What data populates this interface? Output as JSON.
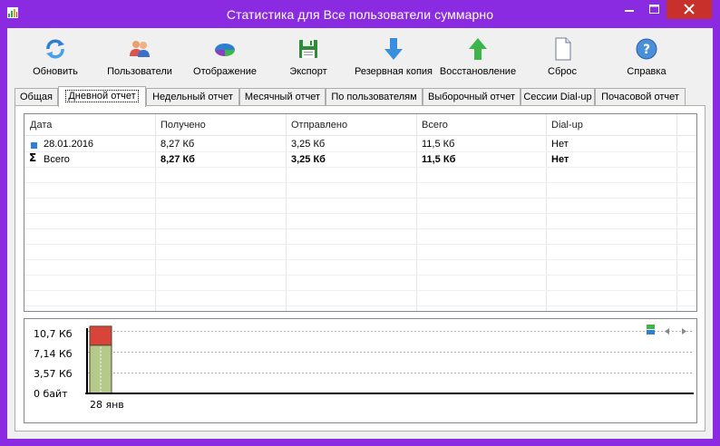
{
  "window": {
    "title": "Статистика для Все пользователи суммарно",
    "icons": {
      "app": "chart-app-icon",
      "minimize": "minimize-icon",
      "maximize": "maximize-icon",
      "close": "close-icon"
    }
  },
  "toolbar": {
    "buttons": [
      {
        "label": "Обновить",
        "icon": "refresh-icon"
      },
      {
        "label": "Пользователи",
        "icon": "users-icon"
      },
      {
        "label": "Отображение",
        "icon": "display-icon"
      },
      {
        "label": "Экспорт",
        "icon": "export-icon"
      },
      {
        "label": "Резервная копия",
        "icon": "backup-icon"
      },
      {
        "label": "Восстановление",
        "icon": "restore-icon"
      },
      {
        "label": "Сброс",
        "icon": "reset-icon"
      },
      {
        "label": "Справка",
        "icon": "help-icon"
      }
    ]
  },
  "tabs": [
    {
      "label": "Общая",
      "active": false
    },
    {
      "label": "Дневной отчет",
      "active": true
    },
    {
      "label": "Недельный отчет",
      "active": false
    },
    {
      "label": "Месячный отчет",
      "active": false
    },
    {
      "label": "По пользователям",
      "active": false
    },
    {
      "label": "Выборочный отчет",
      "active": false
    },
    {
      "label": "Сессии Dial-up",
      "active": false
    },
    {
      "label": "Почасовой отчет",
      "active": false
    }
  ],
  "table": {
    "columns": [
      "Дата",
      "Получено",
      "Отправлено",
      "Всего",
      "Dial-up"
    ],
    "rows": [
      {
        "icon": "blue-square-icon",
        "cells": [
          "28.01.2016",
          "8,27 Кб",
          "3,25 Кб",
          "11,5 Кб",
          "Нет"
        ],
        "bold": false
      },
      {
        "icon": "sigma-icon",
        "cells": [
          "Всего",
          "8,27 Кб",
          "3,25 Кб",
          "11,5 Кб",
          "Нет"
        ],
        "bold": true
      }
    ]
  },
  "chart_data": {
    "type": "bar",
    "stacked": true,
    "categories": [
      "28 янв"
    ],
    "series": [
      {
        "values": [
          8.27
        ],
        "color": "#b5c98a"
      },
      {
        "values": [
          3.25
        ],
        "color": "#d9443a"
      }
    ],
    "ytick_labels": [
      "0 байт",
      "3,57 Кб",
      "7,14 Кб",
      "10,7 Кб"
    ],
    "yticks": [
      0,
      3.57,
      7.14,
      10.7
    ],
    "ylim": [
      0,
      11.5
    ],
    "grid": true,
    "legend_icons": [
      "legend-icon",
      "scroll-left-icon",
      "scroll-right-icon"
    ]
  },
  "colors": {
    "window_frame": "#8a2be2",
    "close_button": "#c7302b",
    "client_background": "#f0f0f0"
  }
}
